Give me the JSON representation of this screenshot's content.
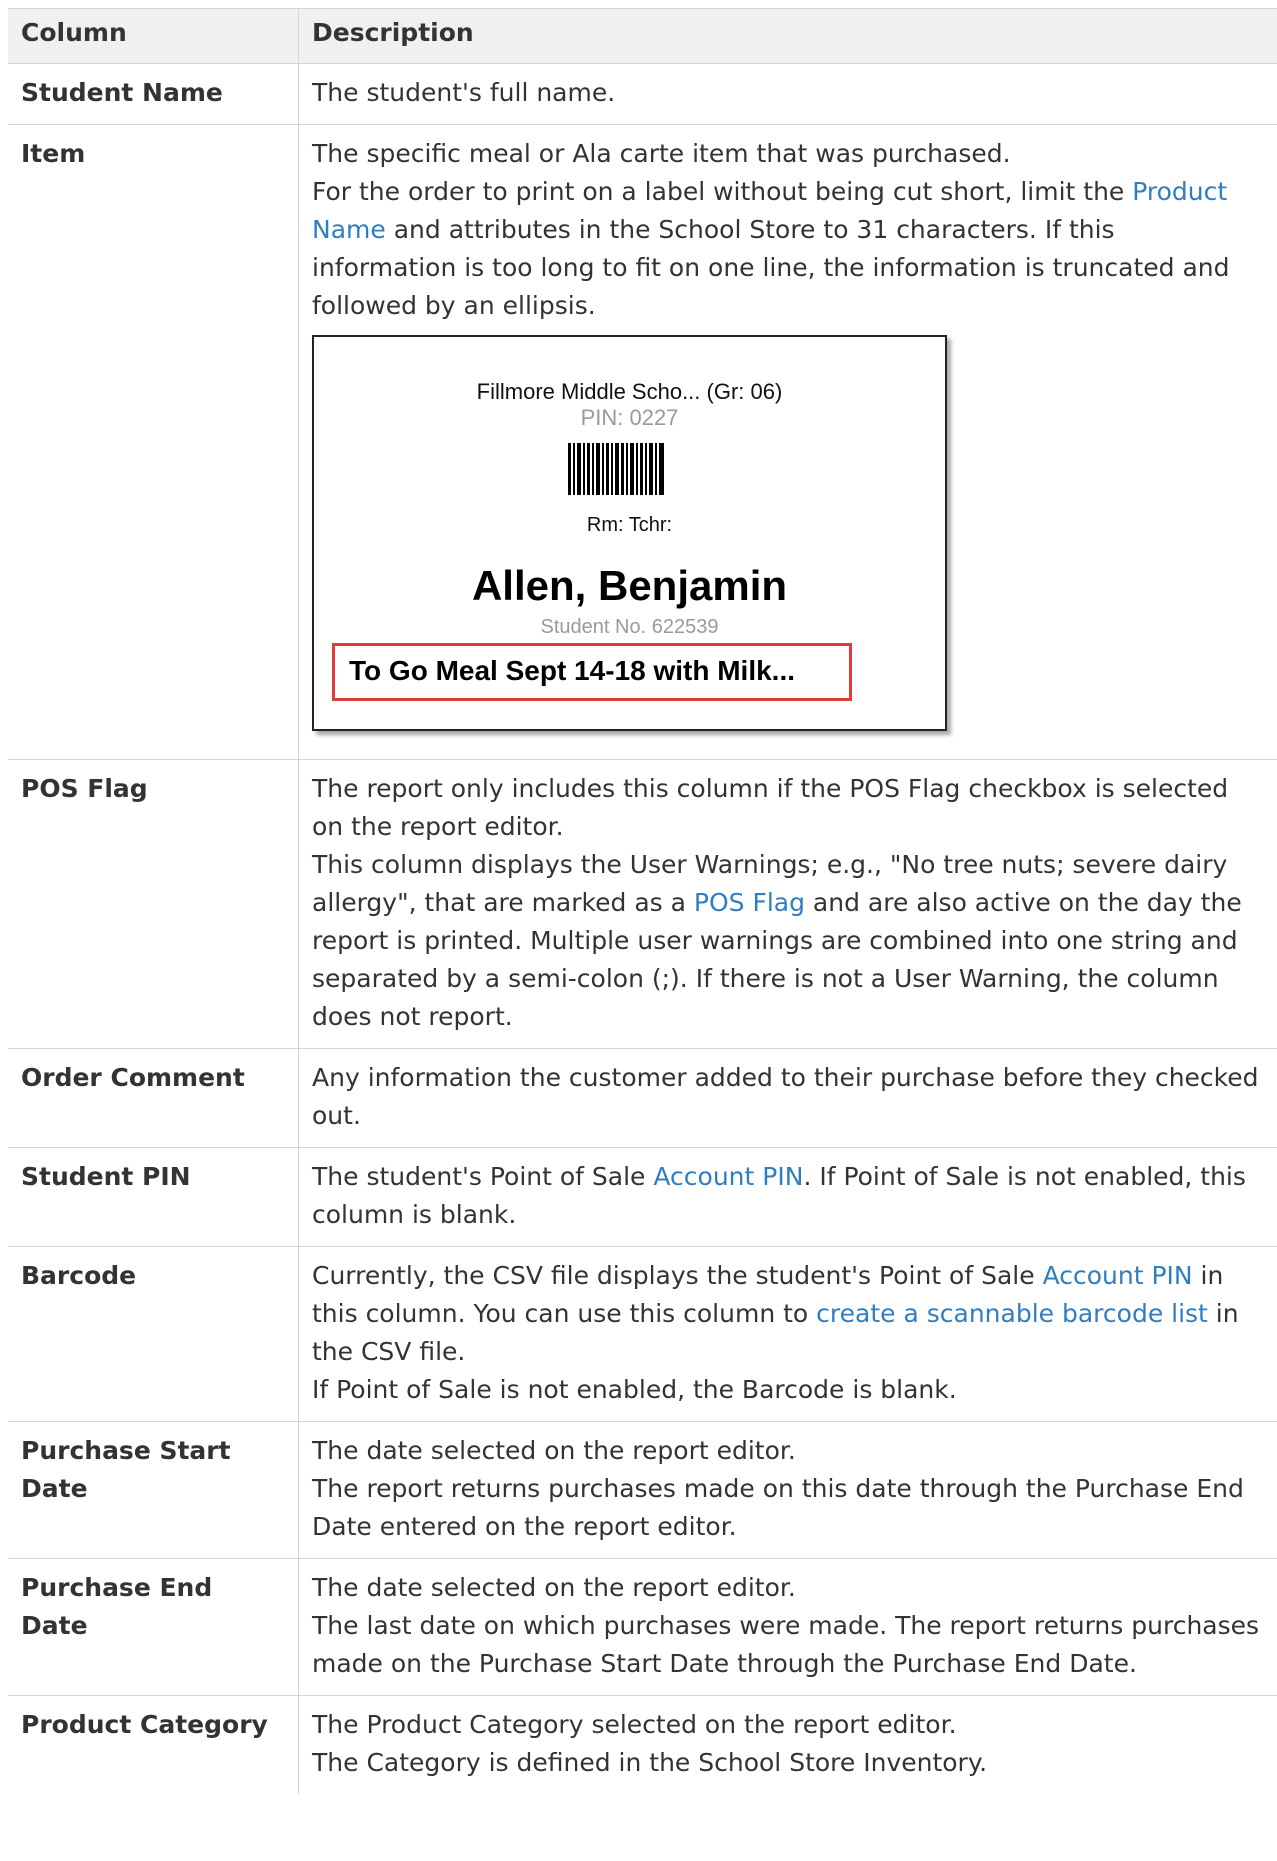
{
  "table": {
    "headers": [
      "Column",
      "Description"
    ],
    "rows": [
      {
        "name": "Student Name",
        "lines": [
          "The student's full name."
        ]
      },
      {
        "name": "Item",
        "line1": "The specific meal or Ala carte item that was purchased.",
        "p2_before": "For the order to print on a label without being cut short, limit the ",
        "p2_link": "Product Name",
        "p2_after": " and attributes in the School Store to 31 characters. If this information is too long to fit on one line, the information is truncated and followed by an ellipsis."
      },
      {
        "name": "POS Flag",
        "line1": "The report only includes this column if the POS Flag checkbox is selected on the report editor.",
        "p2_before": "This column displays the User Warnings; e.g., \"No tree nuts; severe dairy allergy\", that are marked as a ",
        "p2_link": "POS Flag",
        "p2_after": " and are also active on the day the report is printed. Multiple user warnings are combined into one string and separated by a semi-colon (;). If there is not a User Warning, the column does not report."
      },
      {
        "name": "Order Comment",
        "line1": "Any information the customer added to their purchase before they checked out."
      },
      {
        "name": "Student PIN",
        "p_before": "The student's Point of Sale ",
        "p_link": "Account PIN",
        "p_after": ".  If Point of Sale is not enabled, this column is blank."
      },
      {
        "name": "Barcode",
        "p_before": "Currently, the CSV file displays the student's Point of Sale ",
        "p_link": "Account PIN",
        "p_mid": " in this column. You can use this column to ",
        "p_link2": "create a scannable barcode list",
        "p_after": " in the CSV file.",
        "line2": "If Point of Sale is not enabled, the Barcode is blank."
      },
      {
        "name": "Purchase Start Date",
        "line1": "The date selected on the report editor.",
        "line2": "The report returns purchases made on this date through the Purchase End Date entered on the report editor."
      },
      {
        "name": "Purchase End Date",
        "line1": "The date selected on the report editor.",
        "line2": "The last date on which purchases were made. The report returns purchases made on the Purchase Start Date through the Purchase End Date."
      },
      {
        "name": "Product Category",
        "line1": "The Product Category selected on the report editor.",
        "line2": "The Category is defined in the School Store Inventory."
      }
    ]
  },
  "label": {
    "school": "Fillmore Middle Scho... (Gr: 06)",
    "pin": "PIN: 0227",
    "room": "Rm: Tchr:",
    "student_name": "Allen, Benjamin",
    "student_no": "Student No. 622539",
    "item": "To Go Meal Sept 14-18 with Milk...",
    "highlight_color": "#e03c3c"
  },
  "colors": {
    "link": "#2f7ec1",
    "header_bg": "#f0f0f0",
    "text": "#333333"
  }
}
